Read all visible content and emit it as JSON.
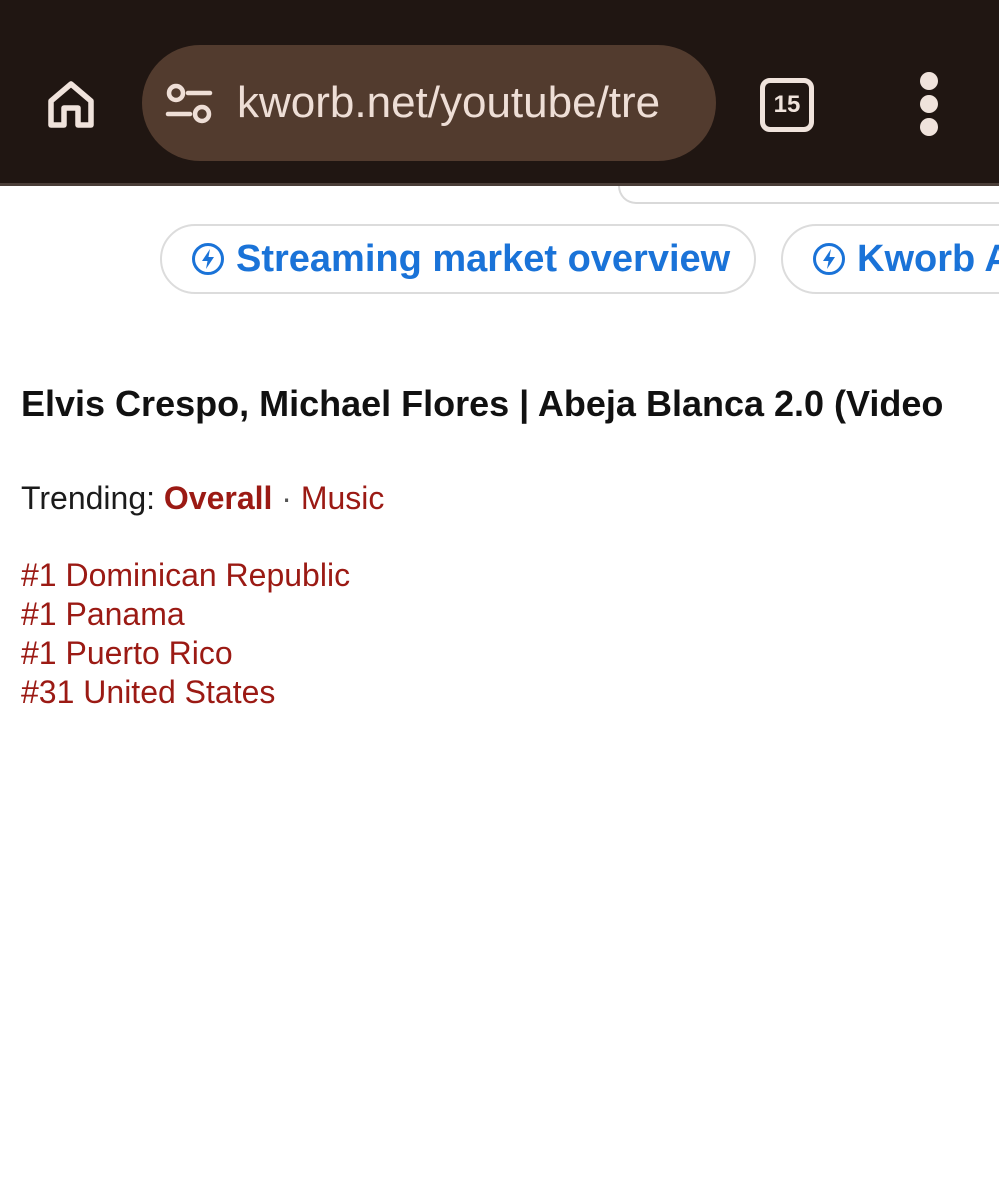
{
  "browser": {
    "url": "kworb.net/youtube/tre",
    "tab_count": "15",
    "icons": {
      "home": "home-icon",
      "site_settings": "tune-icon",
      "menu": "more-vert-icon"
    },
    "colors": {
      "toolbar_bg": "#201612",
      "urlbar_bg": "#523b2e",
      "urlbar_text": "#eeded6"
    }
  },
  "chips": [
    {
      "label": "Streaming market overview",
      "icon": "bolt-circle-icon"
    },
    {
      "label": "Kworb A",
      "icon": "bolt-circle-icon"
    }
  ],
  "page": {
    "title": "Elvis Crespo, Michael Flores | Abeja Blanca 2.0 (Video",
    "trending": {
      "label": "Trending:",
      "overall": "Overall",
      "separator": "·",
      "music": "Music"
    },
    "ranks": [
      "#1 Dominican Republic",
      "#1 Panama",
      "#1 Puerto Rico",
      "#31 United States"
    ],
    "colors": {
      "link": "#9b1a14",
      "chip_text": "#1a73d8"
    }
  }
}
